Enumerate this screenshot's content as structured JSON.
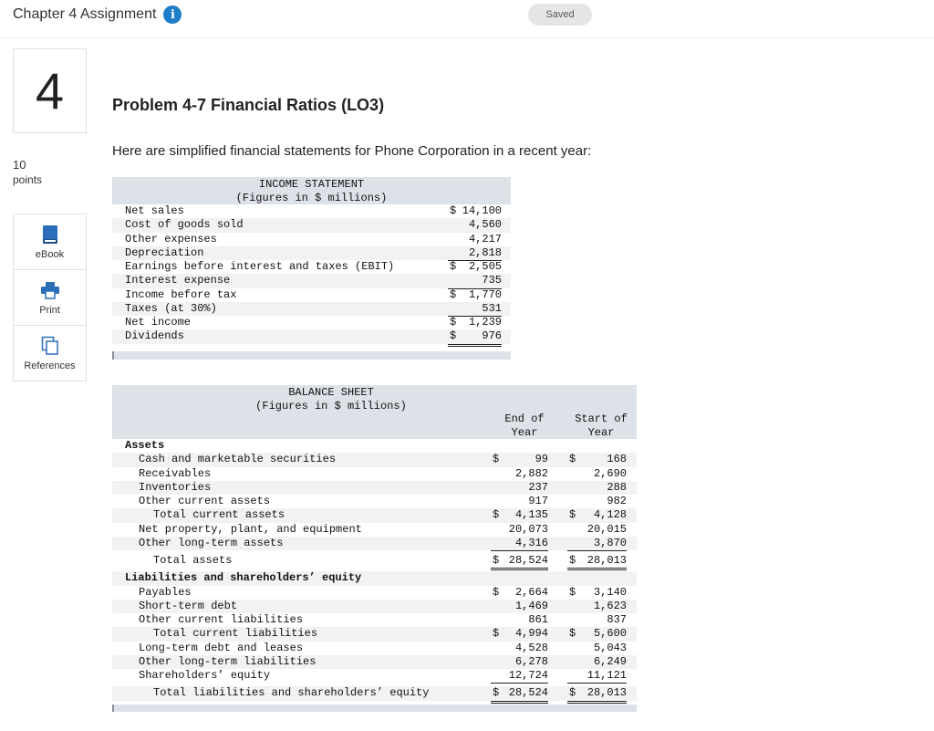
{
  "header": {
    "title": "Chapter 4 Assignment",
    "info_glyph": "i",
    "saved": "Saved"
  },
  "sidebar": {
    "question_number": "4",
    "points_value": "10",
    "points_label": "points",
    "tools": [
      {
        "label": "eBook",
        "icon": "book-icon"
      },
      {
        "label": "Print",
        "icon": "printer-icon"
      },
      {
        "label": "References",
        "icon": "references-icon"
      }
    ]
  },
  "problem": {
    "title": "Problem 4-7 Financial Ratios (LO3)",
    "intro": "Here are simplified financial statements for Phone Corporation in a recent year:"
  },
  "income_statement": {
    "title": "INCOME STATEMENT",
    "subtitle": "(Figures in $ millions)",
    "rows": [
      {
        "label": "Net sales",
        "dollar": "$",
        "value": "14,100"
      },
      {
        "label": "Cost of goods sold",
        "value": "4,560"
      },
      {
        "label": "Other expenses",
        "value": "4,217"
      },
      {
        "label": "Depreciation",
        "value": "2,818"
      },
      {
        "label": "Earnings before interest and taxes (EBIT)",
        "dollar": "$",
        "value": "2,505"
      },
      {
        "label": "Interest expense",
        "value": "735"
      },
      {
        "label": "Income before tax",
        "dollar": "$",
        "value": "1,770"
      },
      {
        "label": "Taxes (at 30%)",
        "value": "531"
      },
      {
        "label": "Net income",
        "dollar": "$",
        "value": "1,239"
      },
      {
        "label": "Dividends",
        "dollar": "$",
        "value": "976"
      }
    ]
  },
  "balance_sheet": {
    "title": "BALANCE SHEET",
    "subtitle": "(Figures in $ millions)",
    "col_end_1": "End of",
    "col_end_2": "Year",
    "col_start_1": "Start of",
    "col_start_2": "Year",
    "rows": [
      {
        "label": "Assets",
        "bold": true
      },
      {
        "label": "Cash and marketable securities",
        "indent": 1,
        "dollar": true,
        "end": "99",
        "start": "168"
      },
      {
        "label": "Receivables",
        "indent": 1,
        "end": "2,882",
        "start": "2,690"
      },
      {
        "label": "Inventories",
        "indent": 1,
        "end": "237",
        "start": "288"
      },
      {
        "label": "Other current assets",
        "indent": 1,
        "end": "917",
        "start": "982"
      },
      {
        "label": "Total current assets",
        "indent": 2,
        "dollar": true,
        "end": "4,135",
        "start": "4,128"
      },
      {
        "label": "Net property, plant, and equipment",
        "indent": 1,
        "end": "20,073",
        "start": "20,015"
      },
      {
        "label": "Other long-term assets",
        "indent": 1,
        "end": "4,316",
        "start": "3,870"
      },
      {
        "label": "Total assets",
        "indent": 2,
        "dollar": true,
        "end": "28,524",
        "start": "28,013"
      },
      {
        "label": "Liabilities and shareholders’ equity",
        "bold": true
      },
      {
        "label": "Payables",
        "indent": 1,
        "dollar": true,
        "end": "2,664",
        "start": "3,140"
      },
      {
        "label": "Short-term debt",
        "indent": 1,
        "end": "1,469",
        "start": "1,623"
      },
      {
        "label": "Other current liabilities",
        "indent": 1,
        "end": "861",
        "start": "837"
      },
      {
        "label": "Total current liabilities",
        "indent": 2,
        "dollar": true,
        "end": "4,994",
        "start": "5,600"
      },
      {
        "label": "Long-term debt and leases",
        "indent": 1,
        "end": "4,528",
        "start": "5,043"
      },
      {
        "label": "Other long-term liabilities",
        "indent": 1,
        "end": "6,278",
        "start": "6,249"
      },
      {
        "label": "Shareholders’ equity",
        "indent": 1,
        "end": "12,724",
        "start": "11,121"
      },
      {
        "label": "Total liabilities and shareholders’ equity",
        "indent": 2,
        "dollar": true,
        "end": "28,524",
        "start": "28,013"
      }
    ]
  }
}
